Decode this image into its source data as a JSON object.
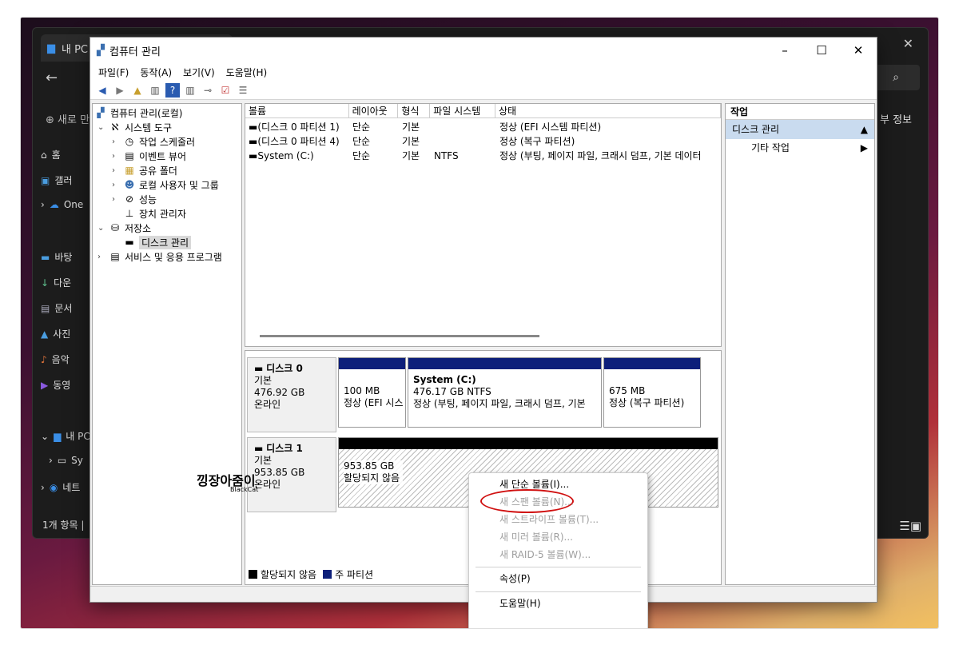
{
  "explorer": {
    "tab_title": "내 PC",
    "new_label": "새로 만",
    "detail_label": "부 정보",
    "nav": [
      "홈",
      "갤러",
      "One",
      "바탕",
      "다운",
      "문서",
      "사진",
      "음악",
      "동영",
      "내 PC",
      "Sy",
      "네트"
    ],
    "status": "1개 항목 |"
  },
  "window": {
    "title": "컴퓨터 관리",
    "menu": [
      "파일(F)",
      "동작(A)",
      "보기(V)",
      "도움말(H)"
    ]
  },
  "tree": {
    "root": "컴퓨터 관리(로컬)",
    "system_tools": "시스템 도구",
    "task_scheduler": "작업 스케줄러",
    "event_viewer": "이벤트 뷰어",
    "shared_folders": "공유 폴더",
    "local_users": "로컬 사용자 및 그룹",
    "performance": "성능",
    "device_manager": "장치 관리자",
    "storage": "저장소",
    "disk_management": "디스크 관리",
    "services": "서비스 및 응용 프로그램"
  },
  "volume_list": {
    "columns": [
      "볼륨",
      "레이아웃",
      "형식",
      "파일 시스템",
      "상태"
    ],
    "rows": [
      [
        "(디스크 0 파티션 1)",
        "단순",
        "기본",
        "",
        "정상 (EFI 시스템 파티션)"
      ],
      [
        "(디스크 0 파티션 4)",
        "단순",
        "기본",
        "",
        "정상 (복구 파티션)"
      ],
      [
        "System (C:)",
        "단순",
        "기본",
        "NTFS",
        "정상 (부팅, 페이지 파일, 크래시 덤프, 기본 데이터"
      ]
    ]
  },
  "disk0": {
    "name": "디스크 0",
    "type": "기본",
    "size": "476.92 GB",
    "state": "온라인",
    "p1_size": "100 MB",
    "p1_status": "정상 (EFI 시스",
    "p2_name": "System  (C:)",
    "p2_size": "476.17 GB NTFS",
    "p2_status": "정상 (부팅, 페이지 파일, 크래시 덤프, 기본",
    "p3_size": "675 MB",
    "p3_status": "정상 (복구 파티션)"
  },
  "disk1": {
    "name": "디스크 1",
    "type": "기본",
    "size": "953.85 GB",
    "state": "온라인",
    "unalloc_size": "953.85 GB",
    "unalloc_label": "할당되지 않음"
  },
  "legend": {
    "unallocated": "할당되지 않음",
    "primary": "주 파티션"
  },
  "actions": {
    "header": "작업",
    "section": "디스크 관리",
    "more": "기타 작업"
  },
  "context_menu": {
    "new_simple": "새 단순 볼륨(I)...",
    "new_spanned": "새 스팬 볼륨(N)...",
    "new_striped": "새 스트라이프 볼륨(T)...",
    "new_mirrored": "새 미러 볼륨(R)...",
    "new_raid5": "새 RAID-5 볼륨(W)...",
    "properties": "속성(P)",
    "help": "도움말(H)"
  },
  "watermark": {
    "main": "낑장아줌이",
    "sub": "BlackCat"
  },
  "colors": {
    "primary_partition": "#0d1f7a",
    "highlight": "#d01010",
    "selection": "#c9dbef"
  }
}
